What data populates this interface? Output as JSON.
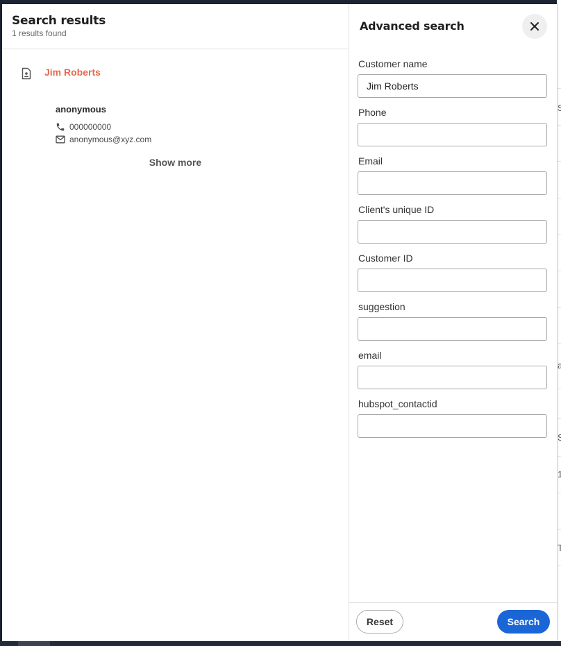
{
  "results": {
    "title": "Search results",
    "count_text": "1 results found",
    "items": [
      {
        "name": "Jim Roberts",
        "contact_name": "anonymous",
        "phone": "000000000",
        "email": "anonymous@xyz.com"
      }
    ],
    "show_more_label": "Show more"
  },
  "advanced": {
    "title": "Advanced search",
    "fields": [
      {
        "label": "Customer name",
        "value": "Jim Roberts"
      },
      {
        "label": "Phone",
        "value": ""
      },
      {
        "label": "Email",
        "value": ""
      },
      {
        "label": "Client's unique ID",
        "value": ""
      },
      {
        "label": "Customer ID",
        "value": ""
      },
      {
        "label": "suggestion",
        "value": ""
      },
      {
        "label": "email",
        "value": ""
      },
      {
        "label": "hubspot_contactid",
        "value": ""
      }
    ],
    "reset_label": "Reset",
    "search_label": "Search"
  },
  "background_fragments": [
    "S",
    "a",
    "S",
    "1",
    "T"
  ],
  "colors": {
    "accent_name": "#e8694f",
    "primary_button": "#1b66d6"
  }
}
